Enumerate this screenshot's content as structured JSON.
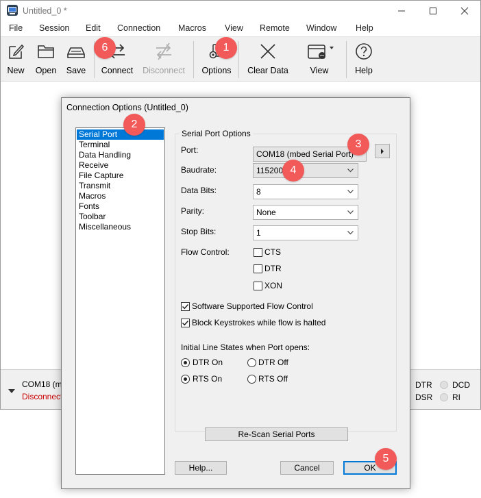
{
  "window": {
    "title": "Untitled_0 *"
  },
  "menu": [
    "File",
    "Session",
    "Edit",
    "Connection",
    "Macros",
    "View",
    "Remote",
    "Window",
    "Help"
  ],
  "toolbar": {
    "new": "New",
    "open": "Open",
    "save": "Save",
    "connect": "Connect",
    "disconnect": "Disconnect",
    "options": "Options",
    "clear_data": "Clear Data",
    "view": "View",
    "help": "Help"
  },
  "status": {
    "port": "COM18 (m",
    "state": "Disconnect",
    "dtr": "DTR",
    "dcd": "DCD",
    "dsr": "DSR",
    "ri": "RI"
  },
  "dialog": {
    "title": "Connection Options (Untitled_0)",
    "categories": [
      "Serial Port",
      "Terminal",
      "Data Handling",
      "Receive",
      "File Capture",
      "Transmit",
      "Macros",
      "Fonts",
      "Toolbar",
      "Miscellaneous"
    ],
    "selected_category": "Serial Port",
    "group_title": "Serial Port Options",
    "port": {
      "label": "Port:",
      "value": "COM18 (mbed Serial Port)"
    },
    "baudrate": {
      "label": "Baudrate:",
      "value": "115200"
    },
    "data_bits": {
      "label": "Data Bits:",
      "value": "8"
    },
    "parity": {
      "label": "Parity:",
      "value": "None"
    },
    "stop_bits": {
      "label": "Stop Bits:",
      "value": "1"
    },
    "flow_control": {
      "label": "Flow Control:",
      "cts": "CTS",
      "dtr": "DTR",
      "xon": "XON"
    },
    "software_flow": "Software Supported Flow Control",
    "block_keystrokes": "Block Keystrokes while flow is halted",
    "initial_states": {
      "label": "Initial Line States when Port opens:",
      "dtr_on": "DTR On",
      "dtr_off": "DTR Off",
      "rts_on": "RTS On",
      "rts_off": "RTS Off"
    },
    "rescan": "Re-Scan Serial Ports",
    "help": "Help...",
    "cancel": "Cancel",
    "ok": "OK"
  },
  "callouts": [
    "1",
    "2",
    "3",
    "4",
    "5",
    "6"
  ],
  "colors": {
    "callout": "#f25a5a",
    "selection": "#0078d7",
    "disconnected": "#cc0000"
  },
  "icons": [
    "app-icon",
    "minimize-icon",
    "maximize-icon",
    "close-icon",
    "new-file-icon",
    "open-folder-icon",
    "save-drive-icon",
    "connect-icon",
    "disconnect-icon",
    "options-gear-icon",
    "clear-x-icon",
    "view-window-icon",
    "help-question-icon",
    "expand-triangle-icon",
    "chevron-down-icon",
    "arrow-right-icon",
    "checkmark-icon"
  ]
}
